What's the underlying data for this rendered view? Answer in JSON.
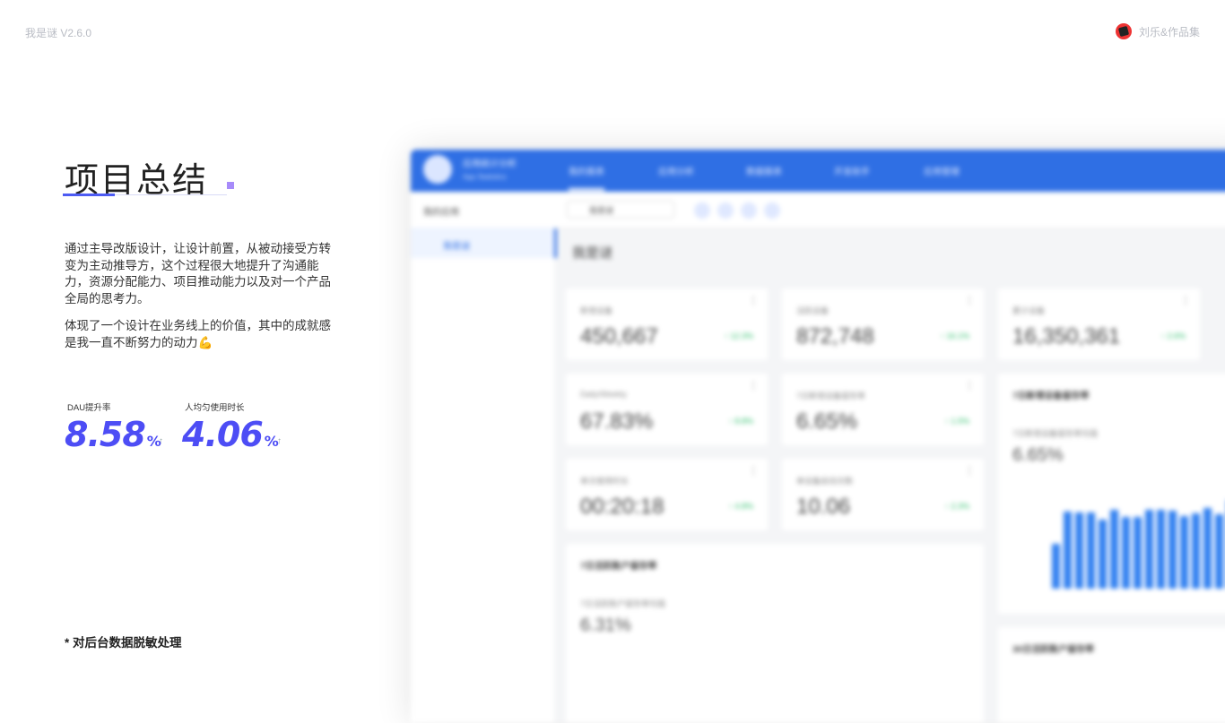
{
  "header": {
    "version_label": "我是谜 V2.6.0",
    "brand_label": "刘乐&作品集"
  },
  "section": {
    "title": "项目总结",
    "paragraph1": "通过主导改版设计，让设计前置，从被动接受方转变为主动推导方，这个过程很大地提升了沟通能力，资源分配能力、项目推动能力以及对一个产品全局的思考力。",
    "paragraph2": "体现了一个设计在业务线上的价值，其中的成就感是我一直不断努力的动力💪"
  },
  "stats": [
    {
      "label": "DAU提升率",
      "value": "8.58",
      "unit": "%",
      "trend": "↑"
    },
    {
      "label": "人均匀使用时长",
      "value": "4.06",
      "unit": "%",
      "trend": "↑"
    }
  ],
  "footnote": "* 对后台数据脱敏处理",
  "mockup": {
    "app_name": "应用统计分析",
    "app_sub": "App Statistics",
    "nav": [
      "我的报表",
      "应用分析",
      "数据报表",
      "开发助手",
      "应用管理"
    ],
    "sidebar_header": "我的应用",
    "sidebar_item": "我是谜",
    "select_value": "我是谜",
    "page_title": "我是谜",
    "cards": [
      {
        "label": "新增设备",
        "value": "450,667",
        "change": "↑ 12.3%"
      },
      {
        "label": "活跃设备",
        "value": "872,748",
        "change": "↑ 16.1%"
      },
      {
        "label": "累计设备",
        "value": "16,350,361",
        "change": "↑ 2.6%"
      },
      {
        "label": "Daily/Weekly",
        "value": "67.83%",
        "change": "↑ 8.8%"
      },
      {
        "label": "7日新增设备留存率",
        "value": "6.65%",
        "change": "↑ 1.5%"
      },
      {
        "label": "单次使用时长",
        "value": "00:20:18",
        "change": "↑ 4.8%"
      },
      {
        "label": "单设备启动次数",
        "value": "10.06",
        "change": "↑ 2.3%"
      }
    ],
    "panel1": {
      "title": "7日活跃账户留存率",
      "sub": "7日活跃账户留存率均值",
      "value": "6.31%"
    },
    "panel2": {
      "title": "7日新增设备留存率",
      "sub": "7日新增设备留存率均值",
      "value": "6.65%"
    },
    "panel3": {
      "title": "30日活跃账户留存率"
    },
    "bars": [
      0.45,
      0.78,
      0.77,
      0.77,
      0.7,
      0.8,
      0.73,
      0.73,
      0.8,
      0.8,
      0.79,
      0.74,
      0.76,
      0.82,
      0.75,
      0.9
    ]
  }
}
